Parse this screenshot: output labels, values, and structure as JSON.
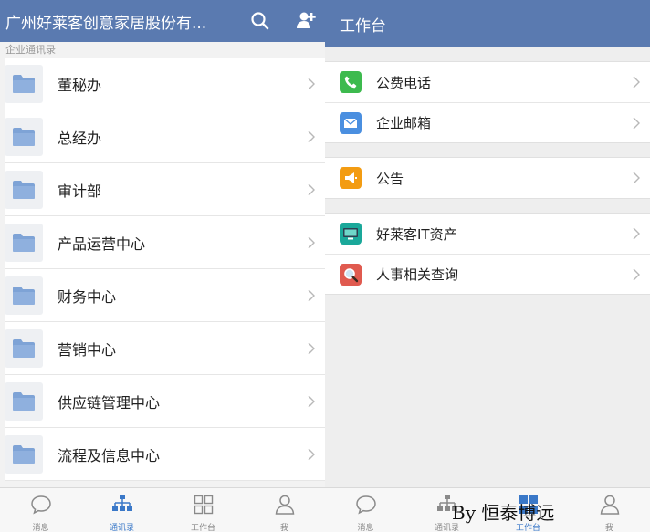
{
  "left_screen": {
    "header": {
      "title": "广州好莱客创意家居股份有..."
    },
    "section_label": "企业通讯录",
    "departments": [
      {
        "label": "董秘办"
      },
      {
        "label": "总经办"
      },
      {
        "label": "审计部"
      },
      {
        "label": "产品运营中心"
      },
      {
        "label": "财务中心"
      },
      {
        "label": "营销中心"
      },
      {
        "label": "供应链管理中心"
      },
      {
        "label": "流程及信息中心"
      }
    ],
    "tabbar": [
      {
        "label": "消息",
        "icon": "chat-icon"
      },
      {
        "label": "通讯录",
        "icon": "org-chart-icon",
        "active": true
      },
      {
        "label": "工作台",
        "icon": "grid-icon"
      },
      {
        "label": "我",
        "icon": "person-icon"
      }
    ]
  },
  "right_screen": {
    "header": {
      "title": "工作台"
    },
    "groups": [
      [
        {
          "label": "公费电话",
          "icon": "phone-icon",
          "color": "#3dba4e"
        },
        {
          "label": "企业邮箱",
          "icon": "mail-icon",
          "color": "#4a8fe0"
        }
      ],
      [
        {
          "label": "公告",
          "icon": "megaphone-icon",
          "color": "#f39c12"
        }
      ],
      [
        {
          "label": "好莱客IT资产",
          "icon": "monitor-icon",
          "color": "#1aa89a"
        },
        {
          "label": "人事相关查询",
          "icon": "magnifier-icon",
          "color": "#e05a4f"
        }
      ]
    ],
    "tabbar": [
      {
        "label": "消息",
        "icon": "chat-icon"
      },
      {
        "label": "通讯录",
        "icon": "org-chart-icon"
      },
      {
        "label": "工作台",
        "icon": "grid-icon",
        "active": true
      },
      {
        "label": "我",
        "icon": "person-icon"
      }
    ]
  },
  "watermark": "By 恒泰博远",
  "colors": {
    "header": "#5a7ab0",
    "active_tab": "#3a78c8",
    "folder": "#7ea3d6"
  }
}
